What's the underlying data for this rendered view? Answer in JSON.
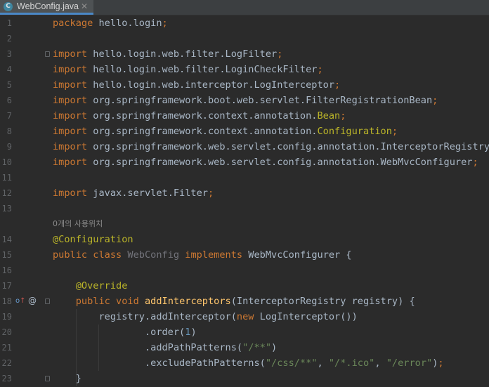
{
  "tab": {
    "title": "WebConfig.java",
    "icon": "C",
    "close": "✕"
  },
  "usage_hint": "0개의 사용위치",
  "gutter": {
    "implements_marker": "o",
    "override_marker": "@"
  },
  "lines": [
    {
      "n": "1",
      "fold": false,
      "tokens": [
        [
          "kw",
          "package"
        ],
        [
          "",
          "hello.login"
        ],
        [
          "kw",
          ";"
        ]
      ]
    },
    {
      "n": "2",
      "fold": false,
      "tokens": []
    },
    {
      "n": "3",
      "fold": true,
      "tokens": [
        [
          "kw",
          "import"
        ],
        [
          "",
          "hello.login.web.filter.LogFilter"
        ],
        [
          "kw",
          ";"
        ]
      ]
    },
    {
      "n": "4",
      "fold": false,
      "tokens": [
        [
          "kw",
          "import"
        ],
        [
          "",
          "hello.login.web.filter.LoginCheckFilter"
        ],
        [
          "kw",
          ";"
        ]
      ]
    },
    {
      "n": "5",
      "fold": false,
      "tokens": [
        [
          "kw",
          "import"
        ],
        [
          "",
          "hello.login.web.interceptor.LogInterceptor"
        ],
        [
          "kw",
          ";"
        ]
      ]
    },
    {
      "n": "6",
      "fold": false,
      "tokens": [
        [
          "kw",
          "import"
        ],
        [
          "",
          "org.springframework.boot.web.servlet.FilterRegistrationBean"
        ],
        [
          "kw",
          ";"
        ]
      ]
    },
    {
      "n": "7",
      "fold": false,
      "tokens": [
        [
          "kw",
          "import"
        ],
        [
          "",
          "org.springframework.context.annotation."
        ],
        [
          "ann",
          "Bean"
        ],
        [
          "kw",
          ";"
        ]
      ]
    },
    {
      "n": "8",
      "fold": false,
      "tokens": [
        [
          "kw",
          "import"
        ],
        [
          "",
          "org.springframework.context.annotation."
        ],
        [
          "ann",
          "Configuration"
        ],
        [
          "kw",
          ";"
        ]
      ]
    },
    {
      "n": "9",
      "fold": false,
      "tokens": [
        [
          "kw",
          "import"
        ],
        [
          "",
          "org.springframework.web.servlet.config.annotation.InterceptorRegistry"
        ],
        [
          "kw",
          ";"
        ]
      ]
    },
    {
      "n": "10",
      "fold": false,
      "tokens": [
        [
          "kw",
          "import"
        ],
        [
          "",
          "org.springframework.web.servlet.config.annotation.WebMvcConfigurer"
        ],
        [
          "kw",
          ";"
        ]
      ]
    },
    {
      "n": "11",
      "fold": false,
      "tokens": []
    },
    {
      "n": "12",
      "fold": false,
      "tokens": [
        [
          "kw",
          "import"
        ],
        [
          "",
          "javax.servlet.Filter"
        ],
        [
          "kw",
          ";"
        ]
      ]
    },
    {
      "n": "13",
      "fold": false,
      "tokens": []
    },
    {
      "n": "14",
      "fold": false,
      "tokens": [
        [
          "ann",
          "@Configuration"
        ]
      ]
    },
    {
      "n": "15",
      "fold": false,
      "tokens": [
        [
          "kw",
          "public class "
        ],
        [
          "unused",
          "WebConfig"
        ],
        [
          "kw",
          " implements "
        ],
        [
          "",
          "WebMvcConfigurer {"
        ]
      ]
    },
    {
      "n": "16",
      "fold": false,
      "tokens": []
    },
    {
      "n": "17",
      "fold": false,
      "tokens": [
        [
          "",
          "    "
        ],
        [
          "ann",
          "@Override"
        ]
      ]
    },
    {
      "n": "18",
      "fold": true,
      "tokens": [
        [
          "",
          "    "
        ],
        [
          "kw",
          "public void "
        ],
        [
          "fn",
          "addInterceptors"
        ],
        [
          "",
          "(InterceptorRegistry registry) {"
        ]
      ]
    },
    {
      "n": "19",
      "fold": false,
      "tokens": [
        [
          "",
          "        registry.addInterceptor("
        ],
        [
          "kw",
          "new "
        ],
        [
          "",
          "LogInterceptor())"
        ]
      ]
    },
    {
      "n": "20",
      "fold": false,
      "tokens": [
        [
          "",
          "                .order("
        ],
        [
          "num",
          "1"
        ],
        [
          "",
          ")"
        ]
      ]
    },
    {
      "n": "21",
      "fold": false,
      "tokens": [
        [
          "",
          "                .addPathPatterns("
        ],
        [
          "str",
          "\"/**\""
        ],
        [
          "",
          ")"
        ]
      ]
    },
    {
      "n": "22",
      "fold": false,
      "tokens": [
        [
          "",
          "                .excludePathPatterns("
        ],
        [
          "str",
          "\"/css/**\""
        ],
        [
          "",
          ", "
        ],
        [
          "str",
          "\"/*.ico\""
        ],
        [
          "",
          ", "
        ],
        [
          "str",
          "\"/error\""
        ],
        [
          "",
          ")"
        ],
        [
          "kw",
          ";"
        ]
      ]
    },
    {
      "n": "23",
      "fold": true,
      "tokens": [
        [
          "",
          "    }"
        ]
      ]
    }
  ]
}
